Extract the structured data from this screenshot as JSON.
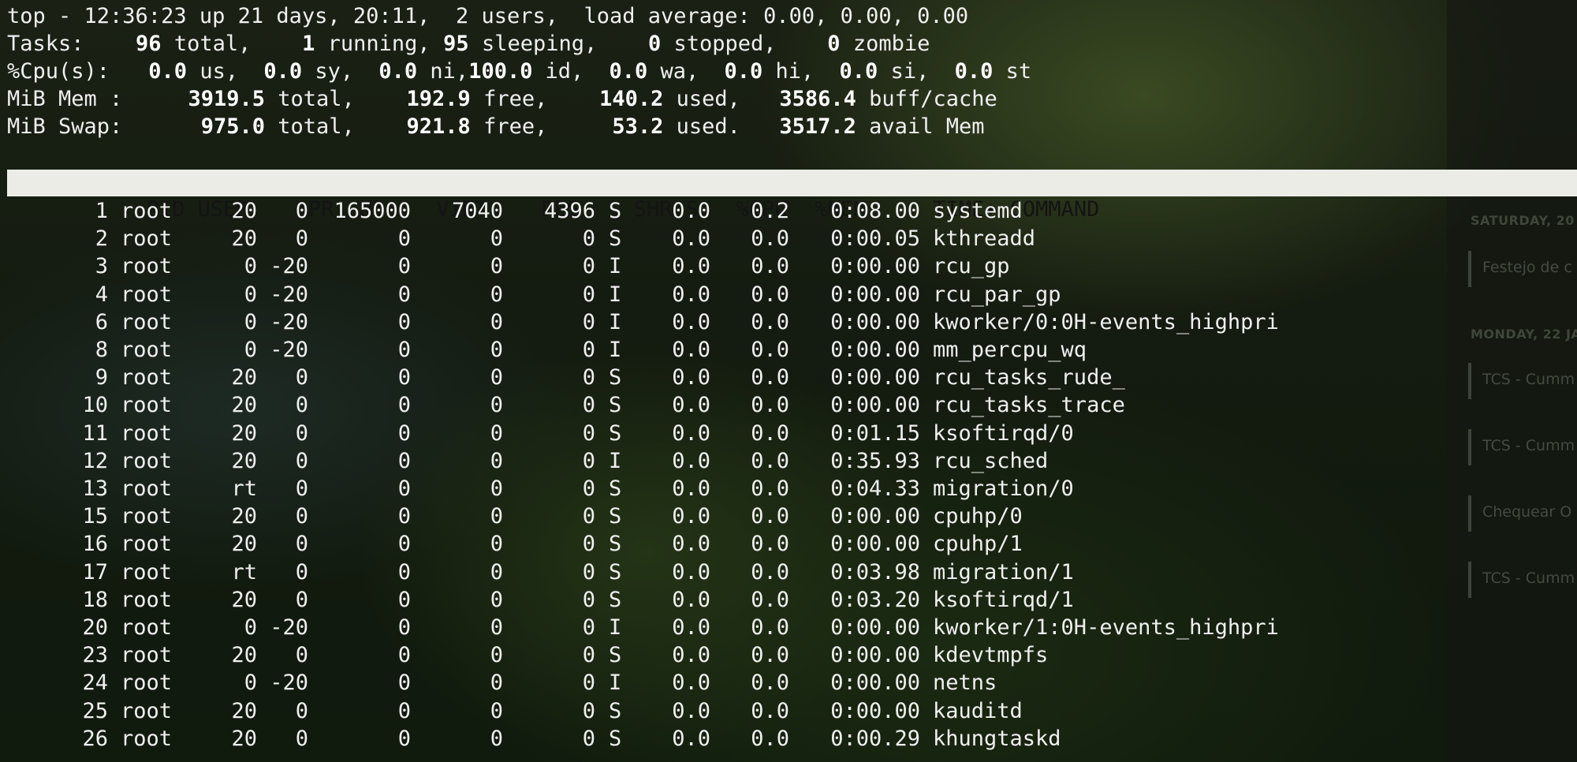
{
  "summary": {
    "line1": "top - 12:36:23 up 21 days, 20:11,  2 users,  load average: 0.00, 0.00, 0.00",
    "tasks": {
      "label": "Tasks:",
      "total": "96",
      "total_label": "total,",
      "running": "1",
      "running_label": "running,",
      "sleeping": "95",
      "sleeping_label": "sleeping,",
      "stopped": "0",
      "stopped_label": "stopped,",
      "zombie": "0",
      "zombie_label": "zombie"
    },
    "cpu": {
      "label": "%Cpu(s):",
      "us": "0.0",
      "us_label": "us,",
      "sy": "0.0",
      "sy_label": "sy,",
      "ni": "0.0",
      "ni_label": "ni,",
      "id": "100.0",
      "id_label": "id,",
      "wa": "0.0",
      "wa_label": "wa,",
      "hi": "0.0",
      "hi_label": "hi,",
      "si": "0.0",
      "si_label": "si,",
      "st": "0.0",
      "st_label": "st"
    },
    "mem": {
      "label": "MiB Mem :",
      "total": "3919.5",
      "total_label": "total,",
      "free": "192.9",
      "free_label": "free,",
      "used": "140.2",
      "used_label": "used,",
      "cache": "3586.4",
      "cache_label": "buff/cache"
    },
    "swap": {
      "label": "MiB Swap:",
      "total": "975.0",
      "total_label": "total,",
      "free": "921.8",
      "free_label": "free,",
      "used": "53.2",
      "used_label": "used.",
      "avail": "3517.2",
      "avail_label": "avail Mem"
    }
  },
  "columns": [
    "PID",
    "USER",
    "PR",
    "NI",
    "VIRT",
    "RES",
    "SHR",
    "S",
    "%CPU",
    "%MEM",
    "TIME+",
    "COMMAND"
  ],
  "processes": [
    [
      "1",
      "root",
      "20",
      "0",
      "165000",
      "7040",
      "4396",
      "S",
      "0.0",
      "0.2",
      "0:08.00",
      "systemd"
    ],
    [
      "2",
      "root",
      "20",
      "0",
      "0",
      "0",
      "0",
      "S",
      "0.0",
      "0.0",
      "0:00.05",
      "kthreadd"
    ],
    [
      "3",
      "root",
      "0",
      "-20",
      "0",
      "0",
      "0",
      "I",
      "0.0",
      "0.0",
      "0:00.00",
      "rcu_gp"
    ],
    [
      "4",
      "root",
      "0",
      "-20",
      "0",
      "0",
      "0",
      "I",
      "0.0",
      "0.0",
      "0:00.00",
      "rcu_par_gp"
    ],
    [
      "6",
      "root",
      "0",
      "-20",
      "0",
      "0",
      "0",
      "I",
      "0.0",
      "0.0",
      "0:00.00",
      "kworker/0:0H-events_highpri"
    ],
    [
      "8",
      "root",
      "0",
      "-20",
      "0",
      "0",
      "0",
      "I",
      "0.0",
      "0.0",
      "0:00.00",
      "mm_percpu_wq"
    ],
    [
      "9",
      "root",
      "20",
      "0",
      "0",
      "0",
      "0",
      "S",
      "0.0",
      "0.0",
      "0:00.00",
      "rcu_tasks_rude_"
    ],
    [
      "10",
      "root",
      "20",
      "0",
      "0",
      "0",
      "0",
      "S",
      "0.0",
      "0.0",
      "0:00.00",
      "rcu_tasks_trace"
    ],
    [
      "11",
      "root",
      "20",
      "0",
      "0",
      "0",
      "0",
      "S",
      "0.0",
      "0.0",
      "0:01.15",
      "ksoftirqd/0"
    ],
    [
      "12",
      "root",
      "20",
      "0",
      "0",
      "0",
      "0",
      "I",
      "0.0",
      "0.0",
      "0:35.93",
      "rcu_sched"
    ],
    [
      "13",
      "root",
      "rt",
      "0",
      "0",
      "0",
      "0",
      "S",
      "0.0",
      "0.0",
      "0:04.33",
      "migration/0"
    ],
    [
      "15",
      "root",
      "20",
      "0",
      "0",
      "0",
      "0",
      "S",
      "0.0",
      "0.0",
      "0:00.00",
      "cpuhp/0"
    ],
    [
      "16",
      "root",
      "20",
      "0",
      "0",
      "0",
      "0",
      "S",
      "0.0",
      "0.0",
      "0:00.00",
      "cpuhp/1"
    ],
    [
      "17",
      "root",
      "rt",
      "0",
      "0",
      "0",
      "0",
      "S",
      "0.0",
      "0.0",
      "0:03.98",
      "migration/1"
    ],
    [
      "18",
      "root",
      "20",
      "0",
      "0",
      "0",
      "0",
      "S",
      "0.0",
      "0.0",
      "0:03.20",
      "ksoftirqd/1"
    ],
    [
      "20",
      "root",
      "0",
      "-20",
      "0",
      "0",
      "0",
      "I",
      "0.0",
      "0.0",
      "0:00.00",
      "kworker/1:0H-events_highpri"
    ],
    [
      "23",
      "root",
      "20",
      "0",
      "0",
      "0",
      "0",
      "S",
      "0.0",
      "0.0",
      "0:00.00",
      "kdevtmpfs"
    ],
    [
      "24",
      "root",
      "0",
      "-20",
      "0",
      "0",
      "0",
      "I",
      "0.0",
      "0.0",
      "0:00.00",
      "netns"
    ],
    [
      "25",
      "root",
      "20",
      "0",
      "0",
      "0",
      "0",
      "S",
      "0.0",
      "0.0",
      "0:00.00",
      "kauditd"
    ],
    [
      "26",
      "root",
      "20",
      "0",
      "0",
      "0",
      "0",
      "S",
      "0.0",
      "0.0",
      "0:00.29",
      "khungtaskd"
    ]
  ],
  "calendar": {
    "dates": [
      "SATURDAY, 20",
      "MONDAY, 22 JA"
    ],
    "events": [
      "Festejo de c",
      "TCS - Cumm",
      "TCS - Cumm",
      "Chequear O",
      "TCS - Cumm"
    ]
  }
}
